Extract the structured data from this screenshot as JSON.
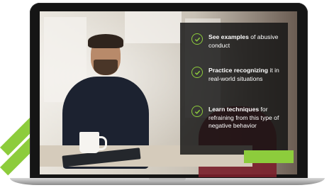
{
  "panel": {
    "bullets": [
      {
        "bold": "See examples",
        "rest": " of abusive conduct"
      },
      {
        "bold": "Practice recognizing",
        "rest": " it in real-world situations"
      },
      {
        "bold": "Learn techniques",
        "rest": " for refraining from this type of negative behavior"
      }
    ]
  },
  "colors": {
    "accent": "#8dcc3c",
    "panel_bg": "#121212",
    "laptop_frame": "#151515"
  },
  "icons": [
    "check-icon",
    "check-icon",
    "check-icon"
  ]
}
